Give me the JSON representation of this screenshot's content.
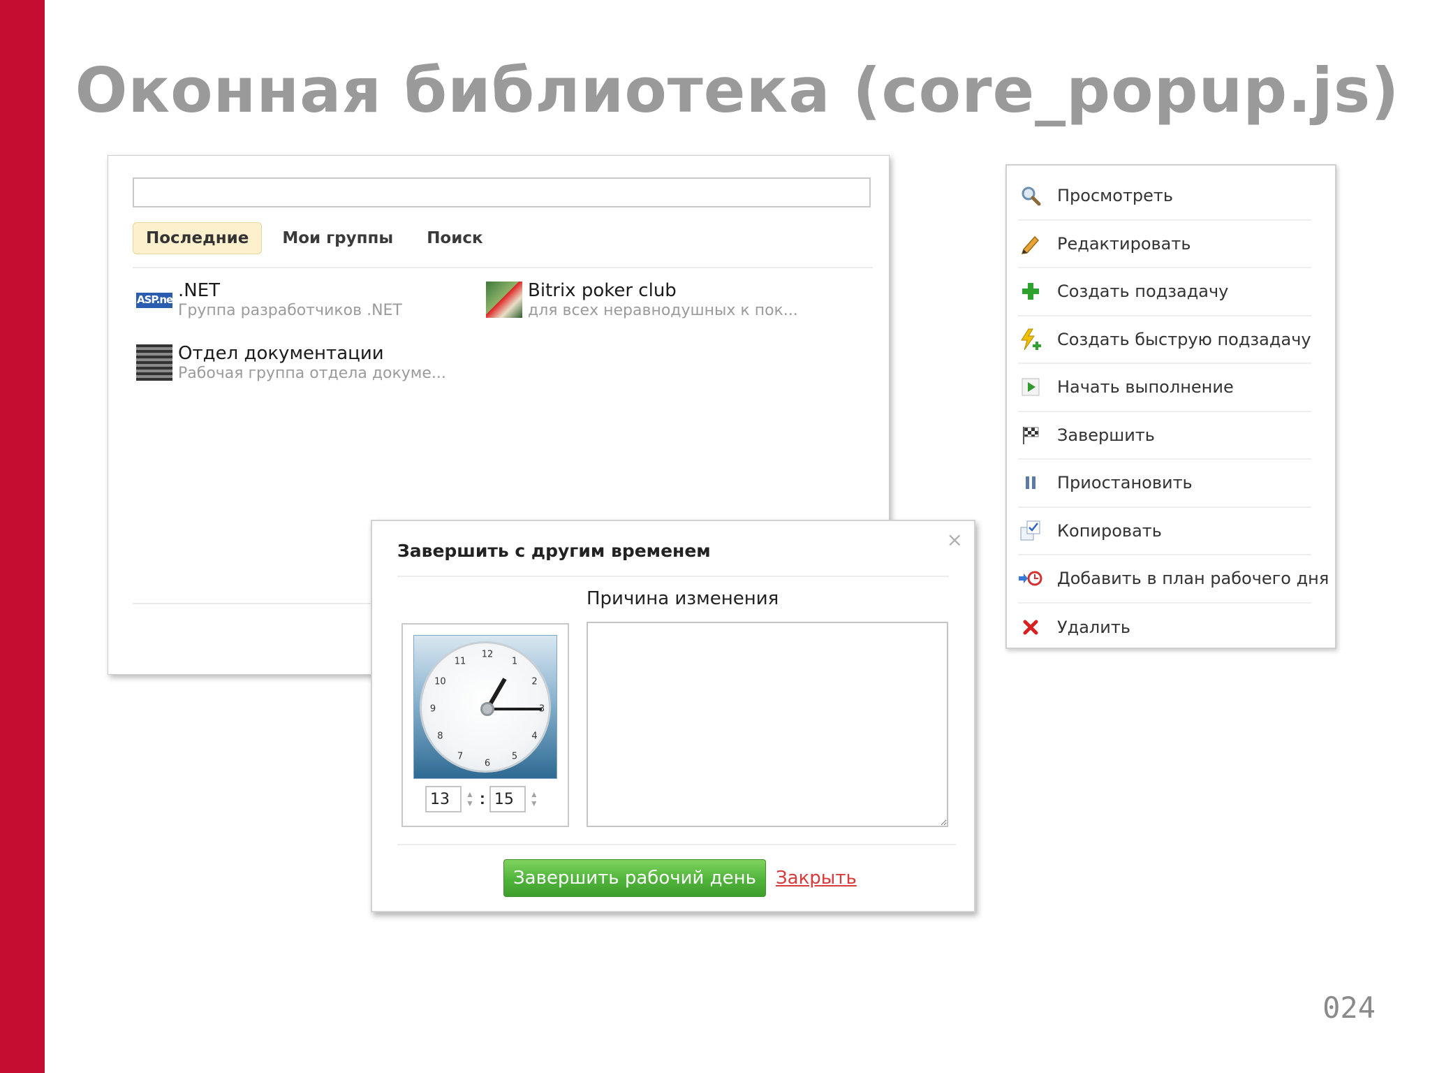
{
  "slide": {
    "title": "Оконная библиотека (core_popup.js)",
    "number": "024"
  },
  "group_popup": {
    "search_value": "",
    "tabs": [
      {
        "label": "Последние",
        "active": true
      },
      {
        "label": "Мои группы",
        "active": false
      },
      {
        "label": "Поиск",
        "active": false
      }
    ],
    "items": [
      {
        "name": ".NET",
        "desc": "Группа разработчиков .NET",
        "thumb_text": "ASP.net"
      },
      {
        "name": "Bitrix poker club",
        "desc": "для всех неравнодушных к пок..."
      },
      {
        "name": "Отдел документации",
        "desc": "Рабочая группа отдела докуме..."
      }
    ]
  },
  "context_menu": {
    "items": [
      {
        "label": "Просмотреть",
        "icon": "magnifier-icon",
        "color": "#6b8fb0"
      },
      {
        "label": "Редактировать",
        "icon": "pencil-icon",
        "color": "#d98b1c"
      },
      {
        "label": "Создать подзадачу",
        "icon": "plus-icon",
        "color": "#2ea12e"
      },
      {
        "label": "Создать быструю подзадачу",
        "icon": "lightning-plus-icon",
        "color": "#e0b400"
      },
      {
        "label": "Начать выполнение",
        "icon": "play-icon",
        "color": "#2e9a2e"
      },
      {
        "label": "Завершить",
        "icon": "checkered-flag-icon",
        "color": "#555555"
      },
      {
        "label": "Приостановить",
        "icon": "pause-icon",
        "color": "#5b7aa6"
      },
      {
        "label": "Копировать",
        "icon": "copy-icon",
        "color": "#4a7fc1"
      },
      {
        "label": "Добавить в план рабочего дня",
        "icon": "clock-plus-icon",
        "color": "#d33030"
      },
      {
        "label": "Удалить",
        "icon": "delete-x-icon",
        "color": "#d82020"
      }
    ]
  },
  "dialog": {
    "title": "Завершить с другим временем",
    "close_glyph": "×",
    "reason_label": "Причина изменения",
    "reason_value": "",
    "clock_numbers": [
      "12",
      "1",
      "2",
      "3",
      "4",
      "5",
      "6",
      "7",
      "8",
      "9",
      "10",
      "11"
    ],
    "hour_value": "13",
    "minute_value": "15",
    "time_separator": ":",
    "submit_label": "Завершить рабочий день",
    "close_link_label": "Закрыть"
  },
  "colors": {
    "accent_bar": "#c40d31",
    "title_gray": "#9a9a9a",
    "submit_green": "#4fb33a",
    "link_red": "#d93b3b",
    "active_tab_bg": "#fcf1cc"
  }
}
